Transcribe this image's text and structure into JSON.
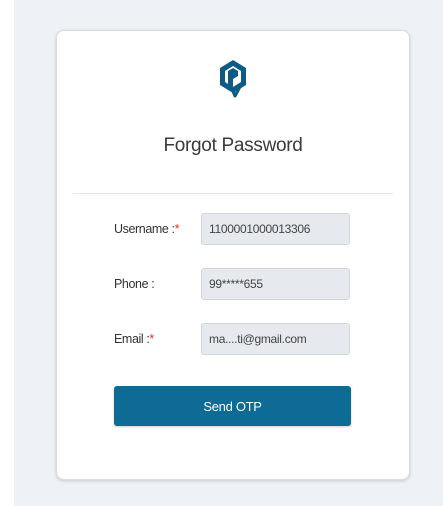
{
  "page": {
    "title": "Forgot Password",
    "accent_color": "#0d6b96",
    "logo_color": "#0c5b84"
  },
  "form": {
    "username": {
      "label": "Username :",
      "required_mark": "*",
      "value": "1100001000013306"
    },
    "phone": {
      "label": "Phone :",
      "value": "99*****655"
    },
    "email": {
      "label": "Email :",
      "required_mark": "*",
      "value": "ma....ti@gmail.com"
    },
    "submit_label": "Send OTP"
  },
  "icons": {
    "logo": "shield-check-logo-icon"
  }
}
